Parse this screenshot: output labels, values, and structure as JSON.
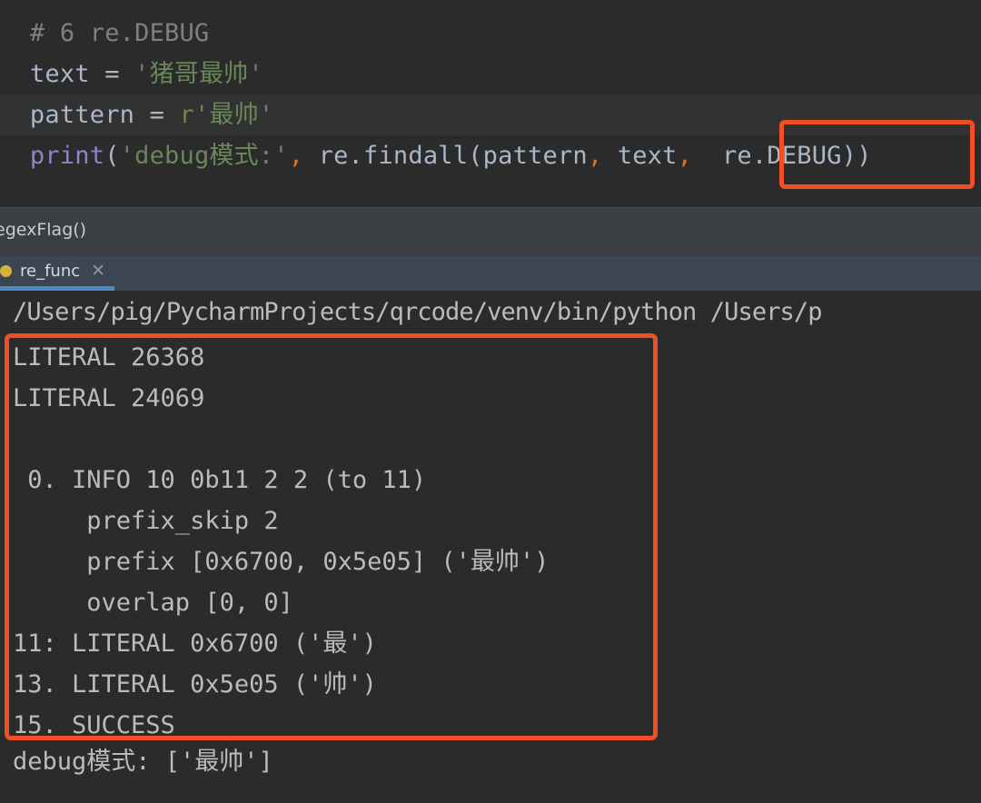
{
  "editor": {
    "lines": [
      {
        "id": "line-comment",
        "tokens": [
          {
            "t": "pad",
            "v": "  "
          },
          {
            "t": "comment",
            "v": "# 6 re.DEBUG"
          }
        ]
      },
      {
        "id": "line-text-assign",
        "tokens": [
          {
            "t": "pad",
            "v": "  "
          },
          {
            "t": "ident",
            "v": "text"
          },
          {
            "t": "op",
            "v": " = "
          },
          {
            "t": "string",
            "v": "'猪哥最帅'"
          }
        ]
      },
      {
        "id": "line-pattern-assign",
        "tokens": [
          {
            "t": "pad",
            "v": "  "
          },
          {
            "t": "ident",
            "v": "pattern"
          },
          {
            "t": "op",
            "v": " = "
          },
          {
            "t": "prefix",
            "v": "r"
          },
          {
            "t": "string",
            "v": "'最帅'"
          }
        ]
      },
      {
        "id": "line-print",
        "tokens": [
          {
            "t": "pad",
            "v": "  "
          },
          {
            "t": "fn",
            "v": "print"
          },
          {
            "t": "punct",
            "v": "("
          },
          {
            "t": "string",
            "v": "'debug模式:'"
          },
          {
            "t": "comma",
            "v": ","
          },
          {
            "t": "ident",
            "v": " re.findall(pattern"
          },
          {
            "t": "comma",
            "v": ","
          },
          {
            "t": "ident",
            "v": " text"
          },
          {
            "t": "comma",
            "v": ","
          },
          {
            "t": "ident",
            "v": "  re.DEBUG))"
          }
        ]
      }
    ],
    "highlighted_line_index": 2,
    "callout_target": "re.DEBUG))"
  },
  "status_strip": {
    "breadcrumb": "egexFlag()"
  },
  "run_tabbar": {
    "tab_label": "re_func",
    "tab_close_glyph": "✕",
    "tab_state_dot": "running-dot"
  },
  "console": {
    "command_line": "/Users/pig/PycharmProjects/qrcode/venv/bin/python /Users/p",
    "output_lines": [
      "LITERAL 26368",
      "LITERAL 24069",
      "",
      " 0. INFO 10 0b11 2 2 (to 11)",
      "     prefix_skip 2",
      "     prefix [0x6700, 0x5e05] ('最帅')",
      "     overlap [0, 0]",
      "11: LITERAL 0x6700 ('最')",
      "13. LITERAL 0x5e05 ('帅')",
      "15. SUCCESS"
    ],
    "final_line": "debug模式: ['最帅']"
  },
  "colors": {
    "background": "#2b2b2b",
    "highlight_line": "#323232",
    "status_strip": "#3c3f41",
    "tabbar": "#3c4552",
    "tab_underline": "#4a88c7",
    "tab_dot": "#d6b13c",
    "callout_orange": "#f04e23",
    "code_default": "#a9b7c6",
    "code_comment": "#808080",
    "code_string": "#6a8759",
    "code_function": "#8888c6",
    "code_comma": "#cc7832",
    "console_text": "#bbbbbb"
  }
}
